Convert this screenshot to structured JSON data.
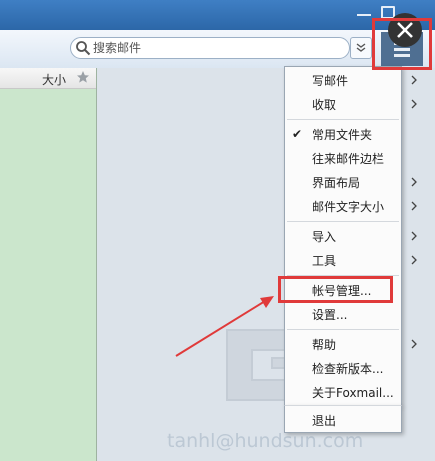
{
  "search": {
    "placeholder": "搜索邮件"
  },
  "list_header": {
    "size": "大小"
  },
  "menu": {
    "items": [
      {
        "label": "写邮件",
        "submenu": true
      },
      {
        "label": "收取",
        "submenu": true
      },
      {
        "label": "常用文件夹",
        "checked": true
      },
      {
        "label": "往来邮件边栏"
      },
      {
        "label": "界面布局",
        "submenu": true
      },
      {
        "label": "邮件文字大小",
        "submenu": true
      },
      {
        "label": "导入",
        "submenu": true
      },
      {
        "label": "工具",
        "submenu": true
      },
      {
        "label": "帐号管理..."
      },
      {
        "label": "设置..."
      },
      {
        "label": "帮助",
        "submenu": true
      },
      {
        "label": "检查新版本..."
      },
      {
        "label": "关于Foxmail..."
      },
      {
        "label": "退出"
      }
    ]
  },
  "watermark": "tanhl@hundsun.com",
  "colors": {
    "highlight": "#e03a3a",
    "titlebar": "#2c67a8"
  }
}
